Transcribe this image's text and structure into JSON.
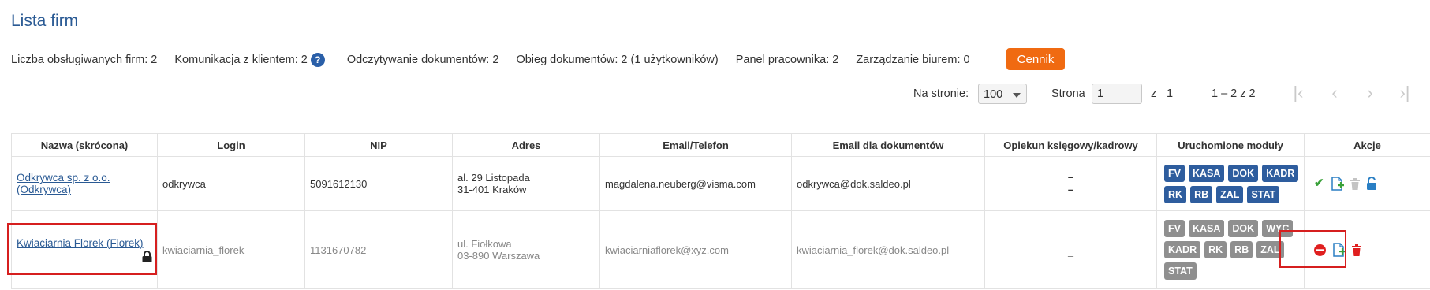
{
  "page": {
    "title": "Lista firm"
  },
  "stats": {
    "firms": "Liczba obsługiwanych firm: 2",
    "communication": "Komunikacja z klientem: 2",
    "reading": "Odczytywanie dokumentów: 2",
    "circulation": "Obieg dokumentów: 2 (1 użytkowników)",
    "employee_panel": "Panel pracownika: 2",
    "office": "Zarządzanie biurem: 0",
    "pricing_button": "Cennik"
  },
  "pagination": {
    "per_page_label": "Na stronie:",
    "per_page_value": "100",
    "page_label": "Strona",
    "page_value": "1",
    "of_label": "z",
    "total_pages": "1",
    "range": "1 – 2 z 2"
  },
  "table": {
    "headers": [
      "Nazwa (skrócona)",
      "Login",
      "NIP",
      "Adres",
      "Email/Telefon",
      "Email dla dokumentów",
      "Opiekun księgowy/kadrowy",
      "Uruchomione moduły",
      "Akcje"
    ],
    "rows": [
      {
        "name": "Odkrywca sp. z o.o. (Odkrywca)",
        "login": "odkrywca",
        "nip": "5091612130",
        "address_line1": "al. 29 Listopada",
        "address_line2": "31-401 Kraków",
        "email": "magdalena.neuberg@visma.com",
        "doc_email": "odkrywca@dok.saldeo.pl",
        "caretaker_1": "–",
        "caretaker_2": "–",
        "modules": [
          "FV",
          "KASA",
          "DOK",
          "KADR",
          "RK",
          "RB",
          "ZAL",
          "STAT"
        ],
        "status": "active"
      },
      {
        "name": "Kwiaciarnia Florek (Florek)",
        "login": "kwiaciarnia_florek",
        "nip": "1131670782",
        "address_line1": "ul. Fiołkowa",
        "address_line2": "03-890 Warszawa",
        "email": "kwiaciarniaflorek@xyz.com",
        "doc_email": "kwiaciarnia_florek@dok.saldeo.pl",
        "caretaker_1": "–",
        "caretaker_2": "–",
        "modules": [
          "FV",
          "KASA",
          "DOK",
          "WYC",
          "KADR",
          "RK",
          "RB",
          "ZAL",
          "STAT"
        ],
        "status": "locked"
      }
    ]
  },
  "colors": {
    "title": "#2a5a94",
    "accent": "#f06a11",
    "module_active": "#2e5d9e",
    "module_inactive": "#8f8f8f",
    "highlight": "#d61f1f"
  }
}
